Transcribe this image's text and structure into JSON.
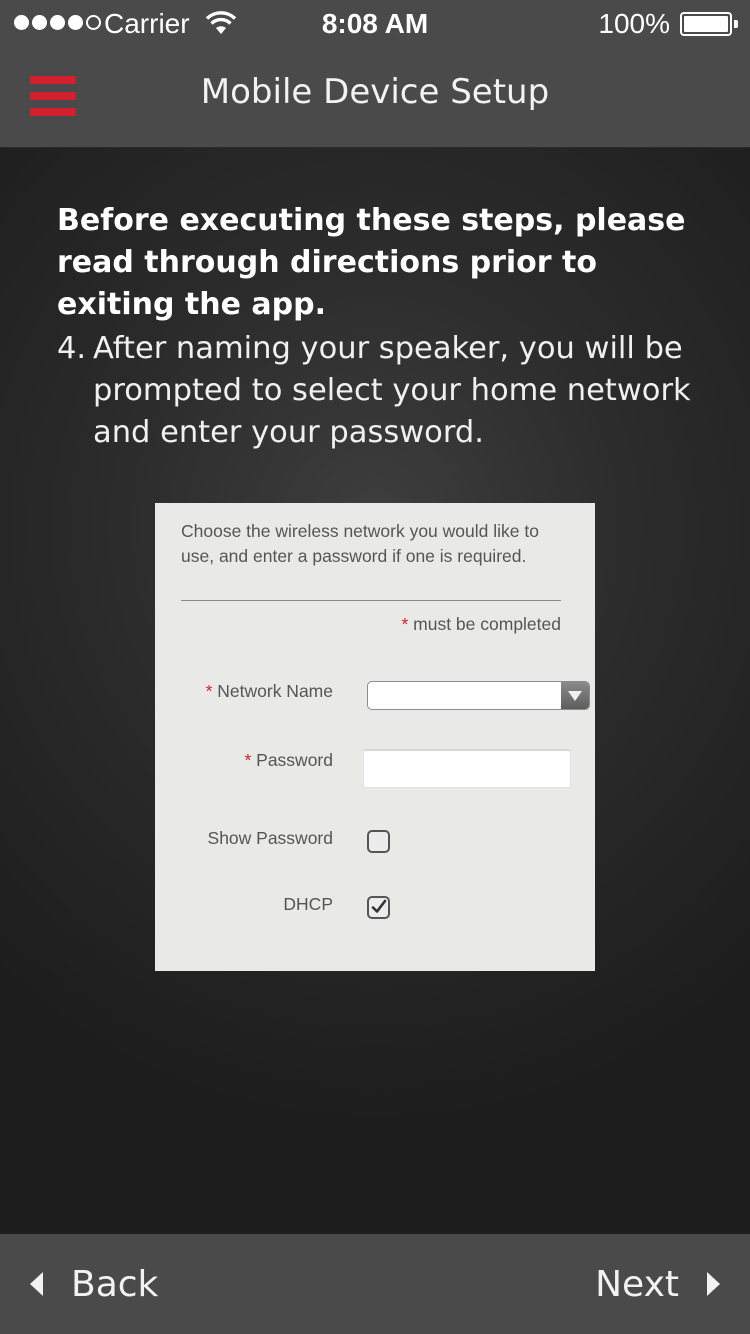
{
  "status_bar": {
    "carrier": "Carrier",
    "time": "8:08 AM",
    "battery": "100%",
    "signal_bars_filled": 4,
    "signal_bars_total": 5
  },
  "nav": {
    "title": "Mobile Device Setup",
    "menu_icon": "hamburger-menu-icon",
    "accent_color": "#d3202e"
  },
  "content": {
    "intro": "Before executing these steps, please read through directions prior to exiting the app.",
    "step_number": "4.",
    "step_text": "After naming your speaker, you will be prompted to select your home network and enter your password."
  },
  "form_screenshot": {
    "description": "Choose the wireless network you would like to use, and enter a password if one is required.",
    "required_marker": "*",
    "must_be_completed": "must be completed",
    "network_name_label": "Network Name",
    "network_name_value": "",
    "password_label": "Password",
    "password_value": "",
    "show_password_label": "Show Password",
    "show_password_checked": false,
    "dhcp_label": "DHCP",
    "dhcp_checked": true
  },
  "footer": {
    "back_label": "Back",
    "next_label": "Next"
  }
}
